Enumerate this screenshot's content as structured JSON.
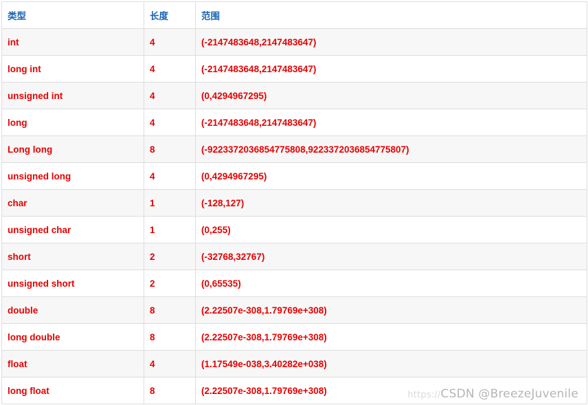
{
  "table": {
    "headers": [
      "类型",
      "长度",
      "范围"
    ],
    "rows": [
      {
        "type": "int",
        "length": "4",
        "range": "(-2147483648,2147483647)"
      },
      {
        "type": "long int",
        "length": "4",
        "range": "(-2147483648,2147483647)"
      },
      {
        "type": "unsigned int",
        "length": "4",
        "range": "(0,4294967295)"
      },
      {
        "type": "long",
        "length": "4",
        "range": "(-2147483648,2147483647)"
      },
      {
        "type": "Long long",
        "length": "8",
        "range": "(-9223372036854775808,9223372036854775807)"
      },
      {
        "type": "unsigned long",
        "length": "4",
        "range": "(0,4294967295)"
      },
      {
        "type": "char",
        "length": "1",
        "range": "(-128,127)"
      },
      {
        "type": "unsigned char",
        "length": "1",
        "range": "(0,255)"
      },
      {
        "type": "short",
        "length": "2",
        "range": "(-32768,32767)"
      },
      {
        "type": "unsigned short",
        "length": "2",
        "range": "(0,65535)"
      },
      {
        "type": "double",
        "length": "8",
        "range": "(2.22507e-308,1.79769e+308)"
      },
      {
        "type": "long double",
        "length": "8",
        "range": "(2.22507e-308,1.79769e+308)"
      },
      {
        "type": "float",
        "length": "4",
        "range": "(1.17549e-038,3.40282e+038)"
      },
      {
        "type": "long float",
        "length": "8",
        "range": "(2.22507e-308,1.79769e+308)"
      }
    ]
  },
  "watermark": {
    "prefix": "https://",
    "text": "CSDN @BreezeJuvenile"
  },
  "colors": {
    "header_text": "#1a64b4",
    "cell_text": "#e60000",
    "stripe": "#f7f7f7",
    "border": "#dddddd"
  }
}
